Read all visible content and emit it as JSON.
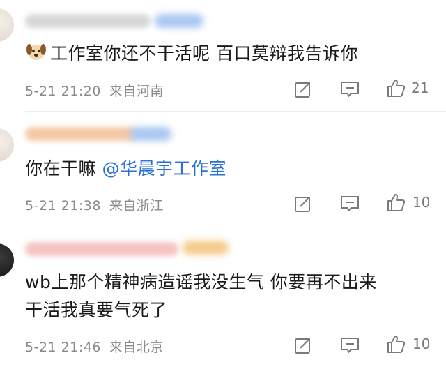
{
  "comments": [
    {
      "text": "工作室你还不干活呢 百口莫辩我告诉你",
      "date": "5-21 21:20",
      "location": "来自河南",
      "likes": "21",
      "name_color": "#d6d6d6",
      "badge_color": "#a9c7f2"
    },
    {
      "text_prefix": "你在干嘛 ",
      "mention": "@华晨宇工作室",
      "date": "5-21 21:38",
      "location": "来自浙江",
      "likes": "10",
      "name_color": "#f5c9a6",
      "badge_color": "#a9c7f2"
    },
    {
      "line1": "wb上那个精神病造谣我没生气 你要再不出来",
      "line2": "干活我真要气死了",
      "date": "5-21 21:46",
      "location": "来自北京",
      "likes": "10",
      "name_color": "#f6c3c3",
      "badge_color": "#f6c98a"
    }
  ],
  "icons": {
    "emoji": "dog-face-icon",
    "share": "share-icon",
    "reply": "comment-icon",
    "like": "thumbs-up-icon"
  }
}
